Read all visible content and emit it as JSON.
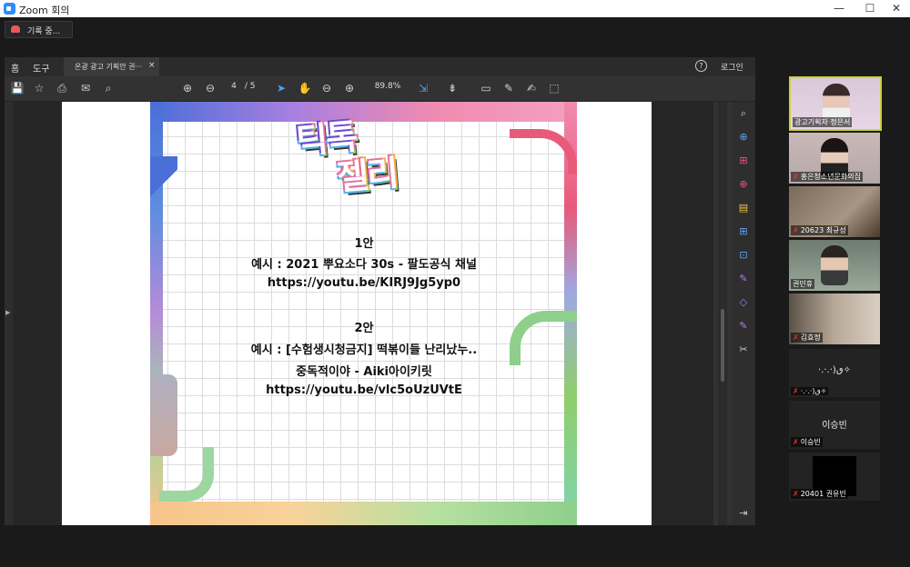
{
  "window": {
    "title": "Zoom 회의",
    "min": "—",
    "max": "☐",
    "close": "✕"
  },
  "recording": {
    "label": "기록 중..."
  },
  "pdf": {
    "tabs": {
      "home": "홈",
      "tools": "도구",
      "doc": "온광 광고 기획안 권···",
      "close": "×"
    },
    "help": "?",
    "login": "로그인",
    "toolbar": {
      "page_current": "4",
      "page_total": "/ 5",
      "zoom": "89.8%"
    },
    "icons": {
      "save": "💾",
      "star": "☆",
      "print": "⎙",
      "mail": "✉",
      "zoomout_search": "⌕",
      "up": "⊕",
      "down": "⊖",
      "cursor": "➤",
      "hand": "✋",
      "minus": "⊖",
      "plus": "⊕",
      "fit": "⇲",
      "scroll": "⇟",
      "comment": "▭",
      "pen": "✎",
      "sign": "✍",
      "stamp": "⬚"
    },
    "slide": {
      "logo_line1": "틱톡",
      "logo_line2": "젤리",
      "lines": [
        "1안",
        "예시 : 2021 뿌요소다 30s - 팔도공식 채널",
        "https://youtu.be/KIRJ9Jg5yp0",
        "2안",
        "예시 : [수험생시청금지] 떡볶이들 난리났누..",
        "중독적이야 - Aiki아이키릿",
        "https://youtu.be/vlc5oUzUVtE"
      ]
    },
    "right_icons": [
      "⌕",
      "⊕",
      "⊞",
      "⊕",
      "▤",
      "⊞",
      "⊡",
      "✎",
      "◇",
      "✎",
      "✂",
      "⇥"
    ]
  },
  "participants": [
    {
      "name": "광고기획자 정은서",
      "muted": false,
      "video": true,
      "active": true
    },
    {
      "name": "홍은청소년문화의집",
      "muted": true,
      "video": true
    },
    {
      "name": "20623 최규성",
      "muted": true,
      "video": true
    },
    {
      "name": "권민휴",
      "muted": false,
      "video": true
    },
    {
      "name": "김효정",
      "muted": true,
      "video": true
    },
    {
      "name": "·.·.·)ٯ✧",
      "display": "·.·.·)ٯ✧",
      "muted": true,
      "video": false
    },
    {
      "name": "이승빈",
      "display": "이승빈",
      "muted": true,
      "video": false
    },
    {
      "name": "20401 권유빈",
      "muted": true,
      "video": false,
      "blackbox": true
    }
  ],
  "mic_icon": "🎤"
}
